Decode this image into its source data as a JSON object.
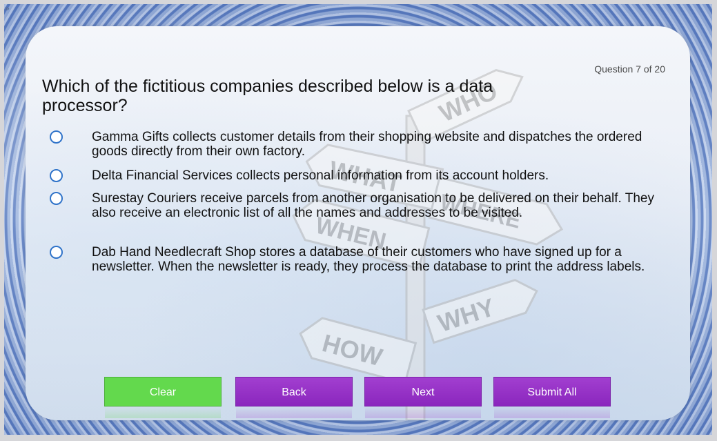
{
  "toolbar": {
    "expand_glyph": "»"
  },
  "quiz": {
    "counter": "Question 7 of 20",
    "question": "Which of the fictitious companies described below is a data processor?",
    "options": [
      {
        "label": "Gamma Gifts collects customer details from their shopping website and dispatches the ordered goods directly from their own factory.",
        "selected": false
      },
      {
        "label": "Delta Financial Services collects personal information from its account holders.",
        "selected": false
      },
      {
        "label": "Surestay Couriers receive parcels from another organisation to be delivered on their behalf. They also receive an electronic list of all the names and addresses to be visited.",
        "selected": false
      },
      {
        "label": "Dab Hand Needlecraft Shop stores a database of their customers who have signed up for a newsletter. When the newsletter is ready, they process the database to print the address labels.",
        "selected": false
      }
    ]
  },
  "background": {
    "sign_words": [
      "WHO",
      "WHAT",
      "WHERE",
      "WHEN",
      "WHY",
      "HOW"
    ]
  },
  "buttons": {
    "clear": "Clear",
    "back": "Back",
    "next": "Next",
    "submit": "Submit All"
  },
  "colors": {
    "radio_border": "#2f73c9",
    "clear_button": "#63d94d",
    "nav_button": "#8a26bd"
  }
}
